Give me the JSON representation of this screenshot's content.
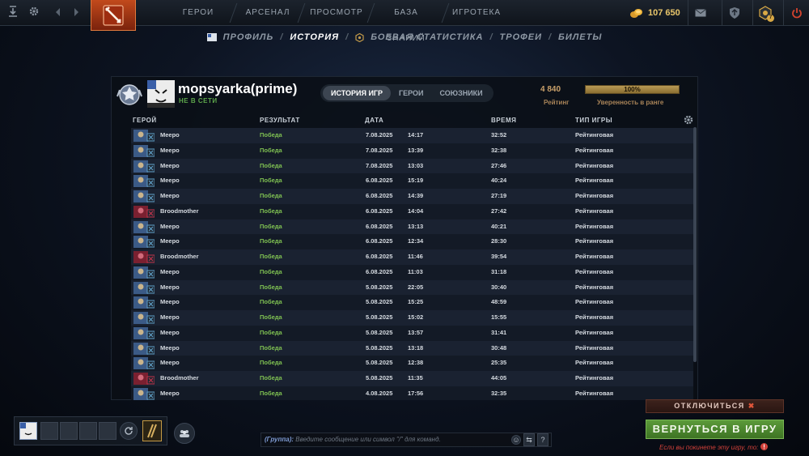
{
  "topbar": {
    "nav": [
      "ГЕРОИ",
      "АРСЕНАЛ",
      "ПРОСМОТР",
      "БАЗА ЗНАНИЙ",
      "ИГРОТЕКА"
    ],
    "gold": "107 650",
    "notification_count": "7"
  },
  "subnav": {
    "items": [
      "ПРОФИЛЬ",
      "ИСТОРИЯ",
      "БОЕВАЯ СТАТИСТИКА",
      "ТРОФЕИ",
      "БИЛЕТЫ"
    ],
    "active_index": 1
  },
  "profile": {
    "username": "mopsyarka(prime)",
    "status": "НЕ В СЕТИ",
    "tabs": [
      "ИСТОРИЯ ИГР",
      "ГЕРОИ",
      "СОЮЗНИКИ"
    ],
    "rating_value": "4 840",
    "rating_label": "Рейтинг",
    "confidence_value": "100%",
    "confidence_label": "Уверенность в ранге"
  },
  "table": {
    "columns": [
      "ГЕРОЙ",
      "РЕЗУЛЬТАТ",
      "ДАТА",
      "ВРЕМЯ",
      "ТИП ИГРЫ"
    ],
    "rows": [
      {
        "hero": "Meepo",
        "result": "Победа",
        "date": "7.08.2025",
        "time": "14:17",
        "duration": "32:52",
        "mode": "Рейтинговая"
      },
      {
        "hero": "Meepo",
        "result": "Победа",
        "date": "7.08.2025",
        "time": "13:39",
        "duration": "32:38",
        "mode": "Рейтинговая"
      },
      {
        "hero": "Meepo",
        "result": "Победа",
        "date": "7.08.2025",
        "time": "13:03",
        "duration": "27:46",
        "mode": "Рейтинговая"
      },
      {
        "hero": "Meepo",
        "result": "Победа",
        "date": "6.08.2025",
        "time": "15:19",
        "duration": "40:24",
        "mode": "Рейтинговая"
      },
      {
        "hero": "Meepo",
        "result": "Победа",
        "date": "6.08.2025",
        "time": "14:39",
        "duration": "27:19",
        "mode": "Рейтинговая"
      },
      {
        "hero": "Broodmother",
        "result": "Победа",
        "date": "6.08.2025",
        "time": "14:04",
        "duration": "27:42",
        "mode": "Рейтинговая"
      },
      {
        "hero": "Meepo",
        "result": "Победа",
        "date": "6.08.2025",
        "time": "13:13",
        "duration": "40:21",
        "mode": "Рейтинговая"
      },
      {
        "hero": "Meepo",
        "result": "Победа",
        "date": "6.08.2025",
        "time": "12:34",
        "duration": "28:30",
        "mode": "Рейтинговая"
      },
      {
        "hero": "Broodmother",
        "result": "Победа",
        "date": "6.08.2025",
        "time": "11:46",
        "duration": "39:54",
        "mode": "Рейтинговая"
      },
      {
        "hero": "Meepo",
        "result": "Победа",
        "date": "6.08.2025",
        "time": "11:03",
        "duration": "31:18",
        "mode": "Рейтинговая"
      },
      {
        "hero": "Meepo",
        "result": "Победа",
        "date": "5.08.2025",
        "time": "22:05",
        "duration": "30:40",
        "mode": "Рейтинговая"
      },
      {
        "hero": "Meepo",
        "result": "Победа",
        "date": "5.08.2025",
        "time": "15:25",
        "duration": "48:59",
        "mode": "Рейтинговая"
      },
      {
        "hero": "Meepo",
        "result": "Победа",
        "date": "5.08.2025",
        "time": "15:02",
        "duration": "15:55",
        "mode": "Рейтинговая"
      },
      {
        "hero": "Meepo",
        "result": "Победа",
        "date": "5.08.2025",
        "time": "13:57",
        "duration": "31:41",
        "mode": "Рейтинговая"
      },
      {
        "hero": "Meepo",
        "result": "Победа",
        "date": "5.08.2025",
        "time": "13:18",
        "duration": "30:48",
        "mode": "Рейтинговая"
      },
      {
        "hero": "Meepo",
        "result": "Победа",
        "date": "5.08.2025",
        "time": "12:38",
        "duration": "25:35",
        "mode": "Рейтинговая"
      },
      {
        "hero": "Broodmother",
        "result": "Победа",
        "date": "5.08.2025",
        "time": "11:35",
        "duration": "44:05",
        "mode": "Рейтинговая"
      },
      {
        "hero": "Meepo",
        "result": "Победа",
        "date": "4.08.2025",
        "time": "17:56",
        "duration": "32:35",
        "mode": "Рейтинговая"
      }
    ]
  },
  "chat": {
    "group_label": "(Группа):",
    "placeholder": "Введите сообщение или символ \"/\" для команд."
  },
  "actions": {
    "disconnect_label": "ОТКЛЮЧИТЬСЯ",
    "return_label": "ВЕРНУТЬСЯ В ИГРУ",
    "leave_warning": "Если вы покинете эту игру, то:"
  },
  "colors": {
    "win": "#7fc152",
    "rating_gold": "#c9a06a",
    "return_green": "#5b9a3a",
    "disconnect_red": "#e0563a"
  }
}
